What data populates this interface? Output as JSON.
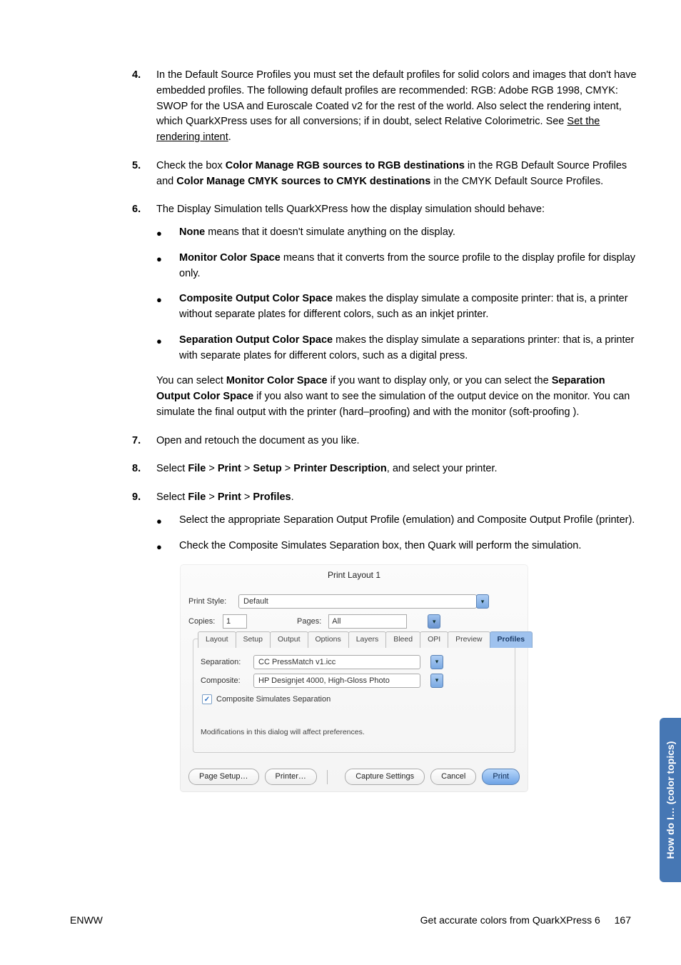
{
  "steps": {
    "s4": {
      "num": "4.",
      "text_a": "In the Default Source Profiles you must set the default profiles for solid colors and images that don't have embedded profiles. The following default profiles are recommended: RGB: Adobe RGB 1998, CMYK: SWOP for the USA and Euroscale Coated v2 for the rest of the world. Also select the rendering intent, which QuarkXPress uses for all conversions; if in doubt, select Relative Colorimetric. See ",
      "link": "Set the rendering intent",
      "text_b": "."
    },
    "s5": {
      "num": "5.",
      "a": "Check the box ",
      "b1": "Color Manage RGB sources to RGB destinations",
      "c": " in the RGB Default Source Profiles and ",
      "b2": "Color Manage CMYK sources to CMYK destinations",
      "d": " in the CMYK Default Source Profiles."
    },
    "s6": {
      "num": "6.",
      "intro": "The Display Simulation tells QuarkXPress how the display simulation should behave:",
      "b1a": "None",
      "b1b": " means that it doesn't simulate anything on the display.",
      "b2a": "Monitor Color Space",
      "b2b": " means that it converts from the source profile to the display profile for display only.",
      "b3a": "Composite Output Color Space",
      "b3b": " makes the display simulate a composite printer: that is, a printer without separate plates for different colors, such as an inkjet printer.",
      "b4a": "Separation Output Color Space",
      "b4b": " makes the display simulate a separations printer: that is, a printer with separate plates for different colors, such as a digital press.",
      "p2a": "You can select ",
      "p2b1": "Monitor Color Space",
      "p2c": " if you want to display only, or you can select the ",
      "p2b2": "Separation Output Color Space",
      "p2d": " if you also want to see the simulation of the output device on the monitor. You can simulate the final output with the printer (hard–proofing) and with the monitor (soft-proofing )."
    },
    "s7": {
      "num": "7.",
      "text": "Open and retouch the document as you like."
    },
    "s8": {
      "num": "8.",
      "a": "Select ",
      "b1": "File",
      "g": " > ",
      "b2": "Print",
      "b3": "Setup",
      "b4": "Printer Description",
      "e": ", and select your printer."
    },
    "s9": {
      "num": "9.",
      "a": "Select ",
      "b1": "File",
      "g": " > ",
      "b2": "Print",
      "b3": "Profiles",
      "e": ".",
      "bl1": "Select the appropriate Separation Output Profile (emulation) and Composite Output Profile (printer).",
      "bl2": "Check the Composite Simulates Separation box, then Quark will perform the simulation."
    }
  },
  "dialog": {
    "title": "Print Layout 1",
    "print_style_label": "Print Style:",
    "print_style_value": "Default",
    "copies_label": "Copies:",
    "copies_value": "1",
    "pages_label": "Pages:",
    "pages_value": "All",
    "tabs": [
      "Layout",
      "Setup",
      "Output",
      "Options",
      "Layers",
      "Bleed",
      "OPI",
      "Preview",
      "Profiles"
    ],
    "separation_label": "Separation:",
    "separation_value": "CC PressMatch v1.icc",
    "composite_label": "Composite:",
    "composite_value": "HP Designjet 4000, High-Gloss Photo",
    "checkbox_label": "Composite Simulates Separation",
    "note": "Modifications in this dialog will affect preferences.",
    "btn_page_setup": "Page Setup…",
    "btn_printer": "Printer…",
    "btn_capture": "Capture Settings",
    "btn_cancel": "Cancel",
    "btn_print": "Print"
  },
  "sidebar": "How do I… (color topics)",
  "footer": {
    "left": "ENWW",
    "right": "Get accurate colors from QuarkXPress 6",
    "page": "167"
  }
}
